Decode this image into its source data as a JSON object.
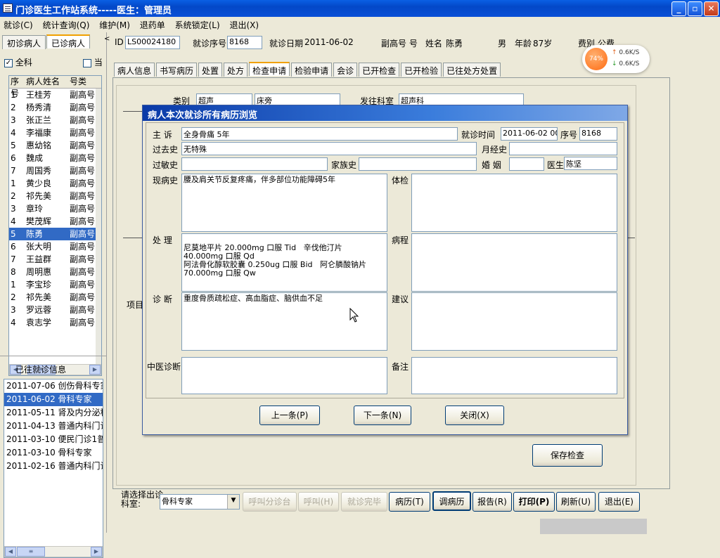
{
  "window": {
    "title": "门诊医生工作站系统-----医生：管理员",
    "min": "_",
    "max": "▫",
    "close": "✕"
  },
  "menu": [
    "就诊(C)",
    "统计查询(Q)",
    "维护(M)",
    "退药单",
    "系统锁定(L)",
    "退出(X)"
  ],
  "left": {
    "tabs": [
      "初诊病人",
      "已诊病人"
    ],
    "all_label": "全科",
    "cur_label": "当",
    "headers": [
      "序号",
      "病人姓名",
      "号类"
    ],
    "patients": [
      {
        "no": "1",
        "name": "王桂芳",
        "type": "副高号"
      },
      {
        "no": "2",
        "name": "杨秀清",
        "type": "副高号"
      },
      {
        "no": "3",
        "name": "张正兰",
        "type": "副高号"
      },
      {
        "no": "4",
        "name": "李福康",
        "type": "副高号"
      },
      {
        "no": "5",
        "name": "惠幼铭",
        "type": "副高号"
      },
      {
        "no": "6",
        "name": "魏成",
        "type": "副高号"
      },
      {
        "no": "7",
        "name": "周国秀",
        "type": "副高号"
      },
      {
        "no": "1",
        "name": "黄少良",
        "type": "副高号"
      },
      {
        "no": "2",
        "name": "祁先美",
        "type": "副高号"
      },
      {
        "no": "3",
        "name": "章玲",
        "type": "副高号"
      },
      {
        "no": "4",
        "name": "樊茂辉",
        "type": "副高号"
      },
      {
        "no": "5",
        "name": "陈勇",
        "type": "副高号"
      },
      {
        "no": "6",
        "name": "张大明",
        "type": "副高号"
      },
      {
        "no": "7",
        "name": "王益群",
        "type": "副高号"
      },
      {
        "no": "8",
        "name": "周明惠",
        "type": "副高号"
      },
      {
        "no": "1",
        "name": "李宝珍",
        "type": "副高号"
      },
      {
        "no": "2",
        "name": "祁先美",
        "type": "副高号"
      },
      {
        "no": "3",
        "name": "罗远蓉",
        "type": "副高号"
      },
      {
        "no": "4",
        "name": "袁志学",
        "type": "副高号"
      }
    ],
    "selected_index": 11,
    "visits_title": "已往就诊信息",
    "visits": [
      "2011-07-06  创伤骨科专家",
      "2011-06-02  骨科专家",
      "2011-05-11  肾及内分泌科",
      "2011-04-13  普通内科门诊",
      "2011-03-10  便民门诊1普",
      "2011-03-10  骨科专家",
      "2011-02-16  普通内科门诊"
    ],
    "visit_selected": 1
  },
  "info": {
    "id_label": "ID",
    "id_value": "LS00024180",
    "seq_label": "就诊序号",
    "seq_value": "8168",
    "date_label": "就诊日期",
    "date_value": "2011-06-02",
    "regtype": "副高号 号",
    "name_label": "姓名",
    "name_value": "陈勇",
    "sex": "男",
    "age_label": "年龄",
    "age_value": "87岁",
    "fee_label": "费别",
    "fee_value": "公费"
  },
  "speed": {
    "percent": "74%",
    "up": "0.6K/S",
    "down": "0.6K/S"
  },
  "subtabs": [
    "病人信息",
    "书写病历",
    "处置",
    "处方",
    "检查申请",
    "检验申请",
    "会诊",
    "已开检查",
    "已开检验",
    "已往处方处置"
  ],
  "subtab_selected": 4,
  "exam": {
    "type_label": "类别",
    "type_value": "超声",
    "bed_value": "床旁",
    "dept_label": "发往科室",
    "dept_value": "超声科",
    "item_label": "项目",
    "save": "保存检查"
  },
  "dialog": {
    "title": "病人本次就诊所有病历浏览",
    "chief_label": "主  诉",
    "chief_value": "全身骨痛 5年",
    "time_label": "就诊时间",
    "time_value": "2011-06-02 00",
    "seq_label": "序号",
    "seq_value": "8168",
    "past_label": "过去史",
    "past_value": "无特殊",
    "mens_label": "月经史",
    "allergy_label": "过敏史",
    "family_label": "家族史",
    "marriage_label": "婚  姻",
    "doctor_label": "医生",
    "doctor_value": "陈坚",
    "present_label": "现病史",
    "present_value": "腰及肩关节反复疼痛，伴多部位功能障碍5年",
    "exam_label": "体检",
    "treat_label": "处  理",
    "treat_value": "\n尼莫地平片 20.000mg 口服 Tid   辛伐他汀片\n40.000mg 口服 Qd\n阿法骨化醇软胶囊 0.250ug 口服 Bid   阿仑膦酸钠片\n70.000mg 口服 Qw",
    "course_label": "病程",
    "diag_label": "诊  断",
    "diag_value": "重度骨质疏松症、高血脂症、脑供血不足",
    "advice_label": "建议",
    "tcm_label": "中医诊断",
    "note_label": "备注",
    "prev": "上一条(P)",
    "next": "下一条(N)",
    "close": "关闭(X)"
  },
  "bottom": {
    "select_label": "请选择出诊科室:",
    "dept": "骨科专家",
    "buttons": [
      "呼叫分诊台",
      "呼叫(H)",
      "就诊完毕",
      "病历(T)",
      "调病历",
      "报告(R)",
      "打印(P)",
      "刷新(U)",
      "退出(E)"
    ]
  }
}
